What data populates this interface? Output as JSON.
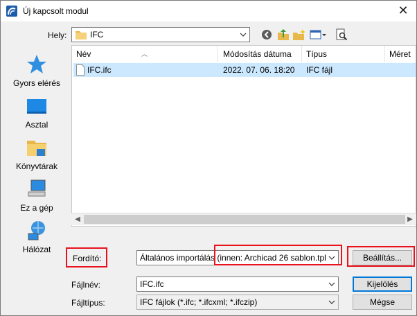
{
  "window": {
    "title": "Új kapcsolt modul",
    "close": "✕"
  },
  "lookin": {
    "label": "Hely:",
    "value": "IFC"
  },
  "places": [
    {
      "label": "Gyors elérés",
      "icon": "star-icon"
    },
    {
      "label": "Asztal",
      "icon": "desktop-icon"
    },
    {
      "label": "Könyvtárak",
      "icon": "libraries-icon"
    },
    {
      "label": "Ez a gép",
      "icon": "computer-icon"
    },
    {
      "label": "Hálózat",
      "icon": "network-icon"
    }
  ],
  "columns": [
    "Név",
    "Módosítás dátuma",
    "Típus",
    "Méret"
  ],
  "files": [
    {
      "name": "IFC.ifc",
      "modified": "2022. 07. 06. 18:20",
      "type": "IFC fájl"
    }
  ],
  "translator": {
    "label": "Fordító:",
    "value": "Általános importálás (innen: Archicad 26 sablon.tpl)",
    "settings_button": "Beállítás..."
  },
  "filename": {
    "label": "Fájlnév:",
    "value": "IFC.ifc",
    "select_button": "Kijelölés"
  },
  "filetype": {
    "label": "Fájltípus:",
    "value": "IFC fájlok (*.ifc; *.ifcxml; *.ifczip)",
    "cancel_button": "Mégse"
  }
}
